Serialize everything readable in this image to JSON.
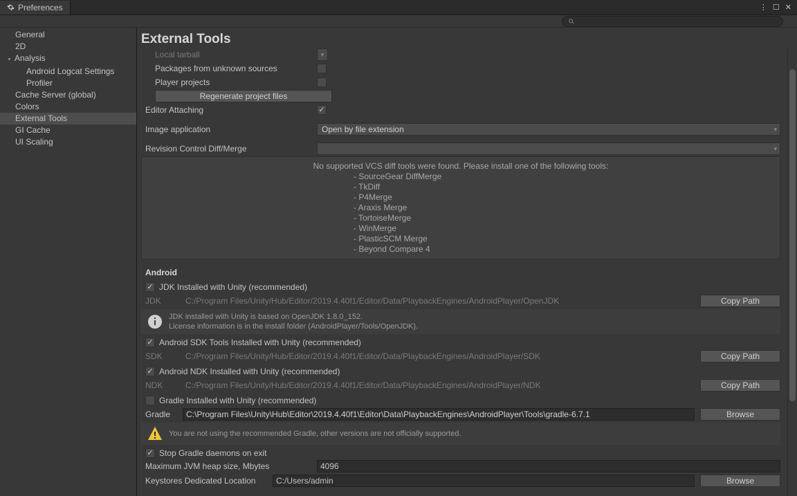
{
  "window": {
    "tab_title": "Preferences"
  },
  "sidebar": {
    "items": [
      {
        "label": "General"
      },
      {
        "label": "2D"
      },
      {
        "label": "Analysis",
        "expandable": true
      },
      {
        "label": "Android Logcat Settings",
        "nested": true
      },
      {
        "label": "Profiler",
        "nested": true
      },
      {
        "label": "Cache Server (global)"
      },
      {
        "label": "Colors"
      },
      {
        "label": "External Tools",
        "selected": true
      },
      {
        "label": "GI Cache"
      },
      {
        "label": "UI Scaling"
      }
    ]
  },
  "header": {
    "title": "External Tools"
  },
  "content": {
    "local_tarball": "Local tarball",
    "unknown_sources": "Packages from unknown sources",
    "player_projects": "Player projects",
    "regen_btn": "Regenerate project files",
    "editor_attaching": "Editor Attaching",
    "image_app_label": "Image application",
    "image_app_value": "Open by file extension",
    "revision_label": "Revision Control Diff/Merge",
    "vcs_message": "No supported VCS diff tools were found. Please install one of the following tools:",
    "vcs_tools": [
      "- SourceGear DiffMerge",
      "- TkDiff",
      "- P4Merge",
      "- Araxis Merge",
      "- TortoiseMerge",
      "- WinMerge",
      "- PlasticSCM Merge",
      "- Beyond Compare 4"
    ],
    "android": {
      "section": "Android",
      "jdk_check": "JDK Installed with Unity (recommended)",
      "jdk_label": "JDK",
      "jdk_path": "C:/Program Files/Unity/Hub/Editor/2019.4.40f1/Editor/Data/PlaybackEngines/AndroidPlayer/OpenJDK",
      "copy_path": "Copy Path",
      "jdk_info_1": "JDK installed with Unity is based on OpenJDK 1.8.0_152.",
      "jdk_info_2": "License information is in the install folder (AndroidPlayer/Tools/OpenJDK).",
      "sdk_check": "Android SDK Tools Installed with Unity (recommended)",
      "sdk_label": "SDK",
      "sdk_path": "C:/Program Files/Unity/Hub/Editor/2019.4.40f1/Editor/Data/PlaybackEngines/AndroidPlayer/SDK",
      "ndk_check": "Android NDK Installed with Unity (recommended)",
      "ndk_label": "NDK",
      "ndk_path": "C:/Program Files/Unity/Hub/Editor/2019.4.40f1/Editor/Data/PlaybackEngines/AndroidPlayer/NDK",
      "gradle_check": "Gradle Installed with Unity (recommended)",
      "gradle_label": "Gradle",
      "gradle_path": "C:\\Program Files\\Unity\\Hub\\Editor\\2019.4.40f1\\Editor\\Data\\PlaybackEngines\\AndroidPlayer\\Tools\\gradle-6.7.1",
      "browse": "Browse",
      "gradle_warn": "You are not using the recommended Gradle, other versions are not officially supported.",
      "stop_daemons": "Stop Gradle daemons on exit",
      "jvm_heap_label": "Maximum JVM heap size, Mbytes",
      "jvm_heap_value": "4096",
      "keystore_label": "Keystores Dedicated Location",
      "keystore_path": "C:/Users/admin"
    }
  }
}
